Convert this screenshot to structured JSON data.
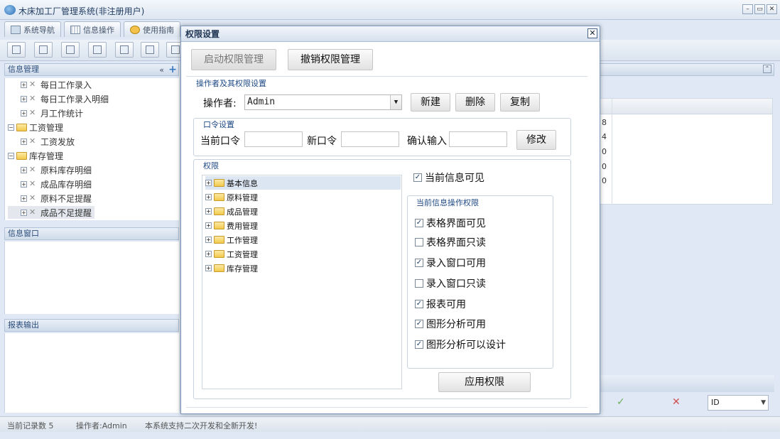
{
  "app": {
    "title": "木床加工厂管理系统(非注册用户)",
    "window_buttons": [
      "–",
      "▭",
      "✕"
    ]
  },
  "nav_tabs": [
    {
      "label": "系统导航",
      "icon": "monitor-icon"
    },
    {
      "label": "信息操作",
      "icon": "grid-icon"
    },
    {
      "label": "使用指南",
      "icon": "help-icon"
    }
  ],
  "left_panel": {
    "info_manage_title": "信息管理",
    "tree": [
      {
        "label": "每日工作录入",
        "type": "item"
      },
      {
        "label": "每日工作录入明细",
        "type": "item"
      },
      {
        "label": "月工作统计",
        "type": "item"
      },
      {
        "label": "工资管理",
        "type": "folder"
      },
      {
        "label": "工资发放",
        "type": "item"
      },
      {
        "label": "库存管理",
        "type": "folder"
      },
      {
        "label": "原料库存明细",
        "type": "item"
      },
      {
        "label": "成品库存明细",
        "type": "item"
      },
      {
        "label": "原料不足提醒",
        "type": "item"
      },
      {
        "label": "成品不足提醒",
        "type": "item",
        "selected": true
      }
    ],
    "info_window_title": "信息窗口",
    "report_title": "报表输出"
  },
  "right_grid": {
    "values": [
      "8",
      "4",
      "0",
      "0",
      "0"
    ],
    "sort_select": "ID"
  },
  "statusbar": {
    "records": "当前记录数 5",
    "operator": "操作者:Admin",
    "notice": "本系统支持二次开发和全新开发!"
  },
  "dialog": {
    "title": "权限设置",
    "close": "✕",
    "enable_btn": "启动权限管理",
    "revoke_btn": "撤销权限管理",
    "operator_section": "操作者及其权限设置",
    "operator_label": "操作者:",
    "operator_value": "Admin",
    "new_btn": "新建",
    "delete_btn": "删除",
    "copy_btn": "复制",
    "password_section": "口令设置",
    "current_pw_label": "当前口令",
    "new_pw_label": "新口令",
    "confirm_label": "确认输入",
    "modify_btn": "修改",
    "permission_section": "权限",
    "perm_tree": [
      "基本信息",
      "原料管理",
      "成品管理",
      "费用管理",
      "工作管理",
      "工资管理",
      "库存管理"
    ],
    "visible_chk": "当前信息可见",
    "ops_section": "当前信息操作权限",
    "ops": [
      {
        "label": "表格界面可见",
        "checked": true
      },
      {
        "label": "表格界面只读",
        "checked": false
      },
      {
        "label": "录入窗口可用",
        "checked": true
      },
      {
        "label": "录入窗口只读",
        "checked": false
      },
      {
        "label": "报表可用",
        "checked": true
      },
      {
        "label": "图形分析可用",
        "checked": true
      },
      {
        "label": "图形分析可以设计",
        "checked": true
      }
    ],
    "apply_btn": "应用权限"
  }
}
